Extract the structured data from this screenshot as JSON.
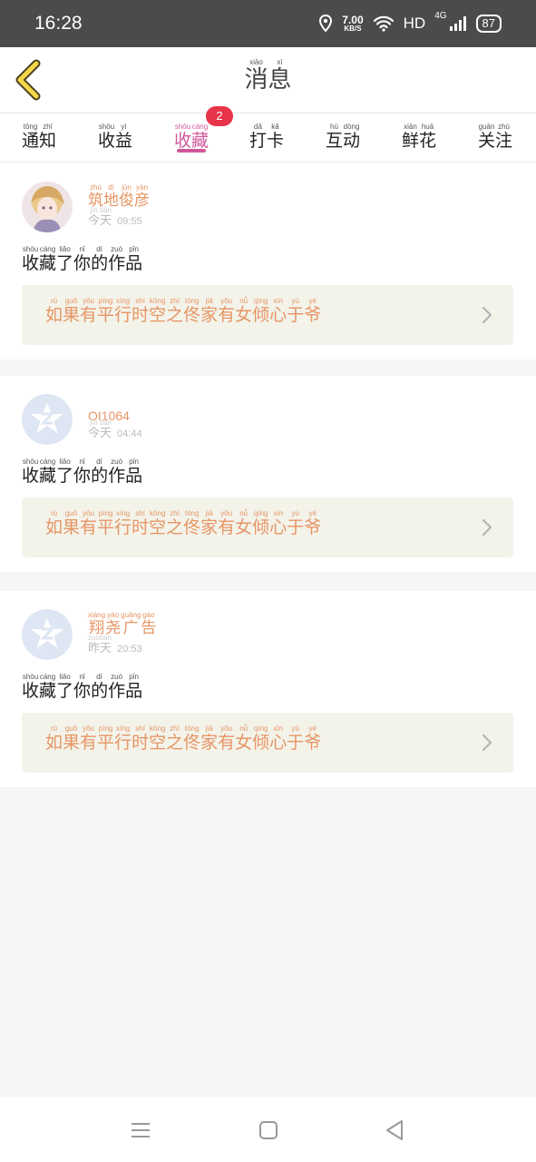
{
  "status": {
    "time": "16:28",
    "speed": "7.00",
    "speed_unit": "KB/S",
    "hd": "HD",
    "network": "4G",
    "battery": "87"
  },
  "header": {
    "title_chars": [
      {
        "c": "消",
        "p": "xiāo"
      },
      {
        "c": "息",
        "p": "xī"
      }
    ]
  },
  "tabs": [
    {
      "chars": [
        {
          "c": "通",
          "p": "tōng"
        },
        {
          "c": "知",
          "p": "zhī"
        }
      ]
    },
    {
      "chars": [
        {
          "c": "收",
          "p": "shōu"
        },
        {
          "c": "益",
          "p": "yì"
        }
      ]
    },
    {
      "chars": [
        {
          "c": "收",
          "p": "shōu"
        },
        {
          "c": "藏",
          "p": "cáng"
        }
      ],
      "active": true,
      "badge": "2"
    },
    {
      "chars": [
        {
          "c": "打",
          "p": "dǎ"
        },
        {
          "c": "卡",
          "p": "kǎ"
        }
      ]
    },
    {
      "chars": [
        {
          "c": "互",
          "p": "hù"
        },
        {
          "c": "动",
          "p": "dòng"
        }
      ]
    },
    {
      "chars": [
        {
          "c": "鲜",
          "p": "xiān"
        },
        {
          "c": "花",
          "p": "huā"
        }
      ]
    },
    {
      "chars": [
        {
          "c": "关",
          "p": "guān"
        },
        {
          "c": "注",
          "p": "zhù"
        }
      ]
    }
  ],
  "messages": [
    {
      "user_chars": [
        {
          "c": "筑",
          "p": "zhù"
        },
        {
          "c": "地",
          "p": "dì"
        },
        {
          "c": "俊",
          "p": "jùn"
        },
        {
          "c": "彦",
          "p": "yàn"
        }
      ],
      "user_plain": "",
      "avatar": "anime",
      "day_chars": [
        {
          "c": "今",
          "p": "jīn"
        },
        {
          "c": "天",
          "p": "tiān"
        }
      ],
      "time": "09:55",
      "action_chars": [
        {
          "c": "收",
          "p": "shōu"
        },
        {
          "c": "藏",
          "p": "cáng"
        },
        {
          "c": "了",
          "p": "liǎo"
        },
        {
          "c": "你",
          "p": "nǐ"
        },
        {
          "c": "的",
          "p": "dí"
        },
        {
          "c": "作",
          "p": "zuò"
        },
        {
          "c": "品",
          "p": "pǐn"
        }
      ],
      "work_chars": [
        {
          "c": "如",
          "p": "rú"
        },
        {
          "c": "果",
          "p": "guǒ"
        },
        {
          "c": "有",
          "p": "yǒu"
        },
        {
          "c": "平",
          "p": "píng"
        },
        {
          "c": "行",
          "p": "xíng"
        },
        {
          "c": "时",
          "p": "shí"
        },
        {
          "c": "空",
          "p": "kōng"
        },
        {
          "c": "之",
          "p": "zhī"
        },
        {
          "c": "佟",
          "p": "tóng"
        },
        {
          "c": "家",
          "p": "jiā"
        },
        {
          "c": "有",
          "p": "yǒu"
        },
        {
          "c": "女",
          "p": "nǚ"
        },
        {
          "c": "倾",
          "p": "qīng"
        },
        {
          "c": "心",
          "p": "xīn"
        },
        {
          "c": "于",
          "p": "yú"
        },
        {
          "c": "爷",
          "p": "yé"
        }
      ]
    },
    {
      "user_chars": [],
      "user_plain": "OI1064",
      "avatar": "default",
      "day_chars": [
        {
          "c": "今",
          "p": "jīn"
        },
        {
          "c": "天",
          "p": "tiān"
        }
      ],
      "time": "04:44",
      "action_chars": [
        {
          "c": "收",
          "p": "shōu"
        },
        {
          "c": "藏",
          "p": "cáng"
        },
        {
          "c": "了",
          "p": "liǎo"
        },
        {
          "c": "你",
          "p": "nǐ"
        },
        {
          "c": "的",
          "p": "dí"
        },
        {
          "c": "作",
          "p": "zuò"
        },
        {
          "c": "品",
          "p": "pǐn"
        }
      ],
      "work_chars": [
        {
          "c": "如",
          "p": "rú"
        },
        {
          "c": "果",
          "p": "guǒ"
        },
        {
          "c": "有",
          "p": "yǒu"
        },
        {
          "c": "平",
          "p": "píng"
        },
        {
          "c": "行",
          "p": "xíng"
        },
        {
          "c": "时",
          "p": "shí"
        },
        {
          "c": "空",
          "p": "kōng"
        },
        {
          "c": "之",
          "p": "zhī"
        },
        {
          "c": "佟",
          "p": "tóng"
        },
        {
          "c": "家",
          "p": "jiā"
        },
        {
          "c": "有",
          "p": "yǒu"
        },
        {
          "c": "女",
          "p": "nǚ"
        },
        {
          "c": "倾",
          "p": "qīng"
        },
        {
          "c": "心",
          "p": "xīn"
        },
        {
          "c": "于",
          "p": "yú"
        },
        {
          "c": "爷",
          "p": "yé"
        }
      ]
    },
    {
      "user_chars": [
        {
          "c": "翔",
          "p": "xiáng"
        },
        {
          "c": "尧",
          "p": "yáo"
        },
        {
          "c": "广",
          "p": "guǎng"
        },
        {
          "c": "告",
          "p": "gào"
        }
      ],
      "user_plain": "",
      "avatar": "default",
      "day_chars": [
        {
          "c": "昨",
          "p": "zuó"
        },
        {
          "c": "天",
          "p": "tiān"
        }
      ],
      "time": "20:53",
      "action_chars": [
        {
          "c": "收",
          "p": "shōu"
        },
        {
          "c": "藏",
          "p": "cáng"
        },
        {
          "c": "了",
          "p": "liǎo"
        },
        {
          "c": "你",
          "p": "nǐ"
        },
        {
          "c": "的",
          "p": "dí"
        },
        {
          "c": "作",
          "p": "zuò"
        },
        {
          "c": "品",
          "p": "pǐn"
        }
      ],
      "work_chars": [
        {
          "c": "如",
          "p": "rú"
        },
        {
          "c": "果",
          "p": "guǒ"
        },
        {
          "c": "有",
          "p": "yǒu"
        },
        {
          "c": "平",
          "p": "píng"
        },
        {
          "c": "行",
          "p": "xíng"
        },
        {
          "c": "时",
          "p": "shí"
        },
        {
          "c": "空",
          "p": "kōng"
        },
        {
          "c": "之",
          "p": "zhī"
        },
        {
          "c": "佟",
          "p": "tóng"
        },
        {
          "c": "家",
          "p": "jiā"
        },
        {
          "c": "有",
          "p": "yǒu"
        },
        {
          "c": "女",
          "p": "nǚ"
        },
        {
          "c": "倾",
          "p": "qīng"
        },
        {
          "c": "心",
          "p": "xīn"
        },
        {
          "c": "于",
          "p": "yú"
        },
        {
          "c": "爷",
          "p": "yé"
        }
      ]
    }
  ],
  "icons": {
    "back": "chevron-left-icon",
    "work_arrow": "chevron-right-icon",
    "nav_menu": "menu-icon",
    "nav_home": "square-icon",
    "nav_back": "triangle-back-icon"
  },
  "colors": {
    "accent": "#d0589a",
    "name": "#e79565",
    "badge": "#e8344a",
    "work_bg": "#f3f3ea"
  }
}
